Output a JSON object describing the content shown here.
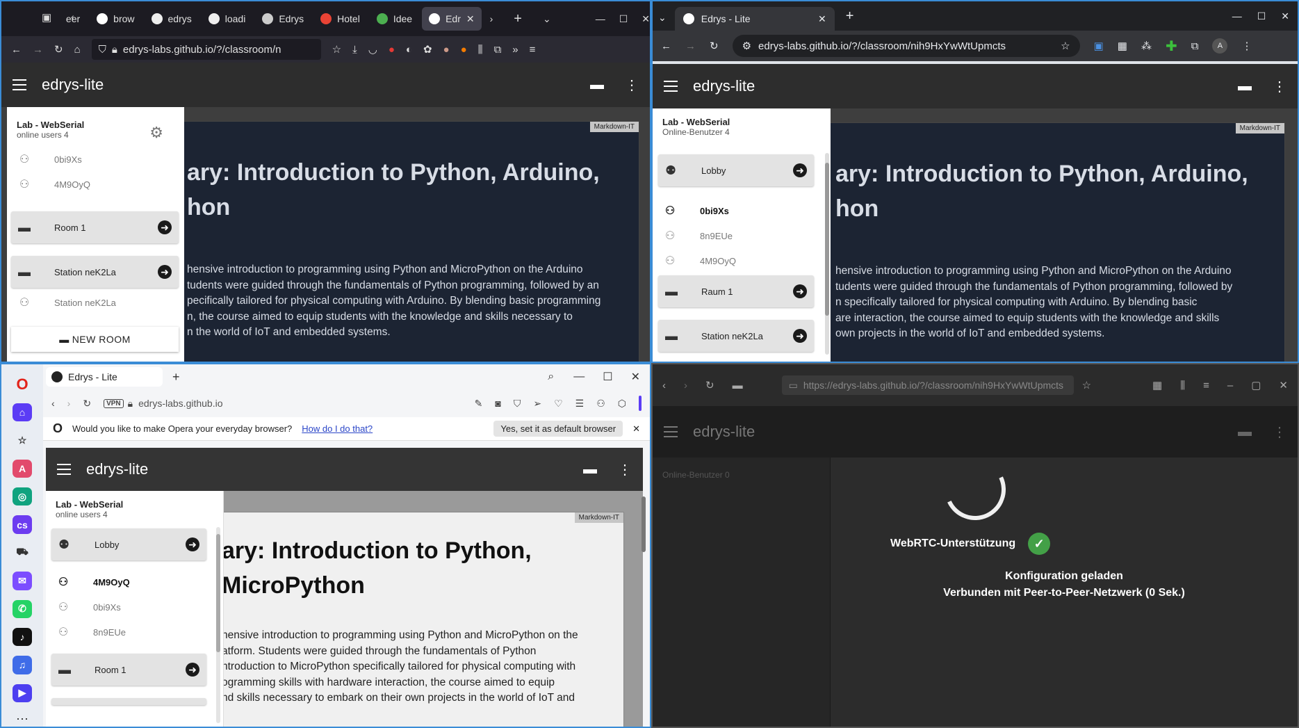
{
  "q1": {
    "tabs": [
      "eer",
      "brow",
      "edrys",
      "loadi",
      "Edrys",
      "Hotel",
      "Idee",
      "Edr"
    ],
    "url": "edrys-labs.github.io/?/classroom/n",
    "app_title": "edrys-lite",
    "lab_title": "Lab - WebSerial",
    "online_users": "online users 4",
    "users": [
      "0bi9Xs",
      "4M9OyQ"
    ],
    "room1": "Room 1",
    "station": "Station neK2La",
    "station_user": "Station neK2La",
    "new_room": "NEW ROOM",
    "badge": "Markdown-IT",
    "title_line1": "ary: Introduction to Python, Arduino,",
    "title_line2": "hon",
    "para": [
      "hensive introduction to programming using Python and MicroPython on the Arduino",
      "tudents were guided through the fundamentals of Python programming, followed by an",
      "pecifically tailored for physical computing with Arduino. By blending basic programming",
      "n, the course aimed to equip students with the knowledge and skills necessary to",
      "n the world of IoT and embedded systems."
    ]
  },
  "q2": {
    "tab_title": "Edrys - Lite",
    "url": "edrys-labs.github.io/?/classroom/nih9HxYwWtUpmcts",
    "avatar": "A",
    "app_title": "edrys-lite",
    "lab_title": "Lab - WebSerial",
    "online_users": "Online-Benutzer 4",
    "lobby": "Lobby",
    "users": [
      {
        "name": "0bi9Xs",
        "bold": true
      },
      {
        "name": "8n9EUe",
        "bold": false
      },
      {
        "name": "4M9OyQ",
        "bold": false
      }
    ],
    "room1": "Raum 1",
    "station": "Station neK2La",
    "badge": "Markdown-IT",
    "title_line1": "ary: Introduction to Python, Arduino,",
    "title_line2": "hon",
    "para": [
      "hensive introduction to programming using Python and MicroPython on the Arduino",
      "tudents were guided through the fundamentals of Python programming, followed by",
      "n specifically tailored for physical computing with Arduino. By blending basic",
      "are interaction, the course aimed to equip students with the knowledge and skills",
      "own projects in the world of IoT and embedded systems."
    ]
  },
  "q3": {
    "tab_title": "Edrys - Lite",
    "url": "edrys-labs.github.io",
    "vpn": "VPN",
    "banner_text": "Would you like to make Opera your everyday browser?",
    "banner_link": "How do I do that?",
    "banner_button": "Yes, set it as default browser",
    "app_title": "edrys-lite",
    "lab_title": "Lab - WebSerial",
    "online_users": "online users 4",
    "lobby": "Lobby",
    "users": [
      {
        "name": "4M9OyQ",
        "bold": true
      },
      {
        "name": "0bi9Xs",
        "bold": false
      },
      {
        "name": "8n9EUe",
        "bold": false
      }
    ],
    "room1": "Room 1",
    "badge": "Markdown-IT",
    "title_line1": "ary: Introduction to Python,",
    "title_line2": "MicroPython",
    "para": [
      "hensive introduction to programming using Python and MicroPython on the",
      "atform. Students were guided through the fundamentals of Python",
      "ntroduction to MicroPython specifically tailored for physical computing with",
      "ogramming skills with hardware interaction, the course aimed to equip",
      "nd skills necessary to embark on their own projects in the world of IoT and"
    ]
  },
  "q4": {
    "url": "https://edrys-labs.github.io/?/classroom/nih9HxYwWtUpmcts",
    "app_title": "edrys-lite",
    "online_users": "Online-Benutzer 0",
    "webrtc": "WebRTC-Unterstützung",
    "config": "Konfiguration geladen",
    "connected": "Verbunden mit Peer-to-Peer-Netzwerk (0 Sek.)"
  }
}
